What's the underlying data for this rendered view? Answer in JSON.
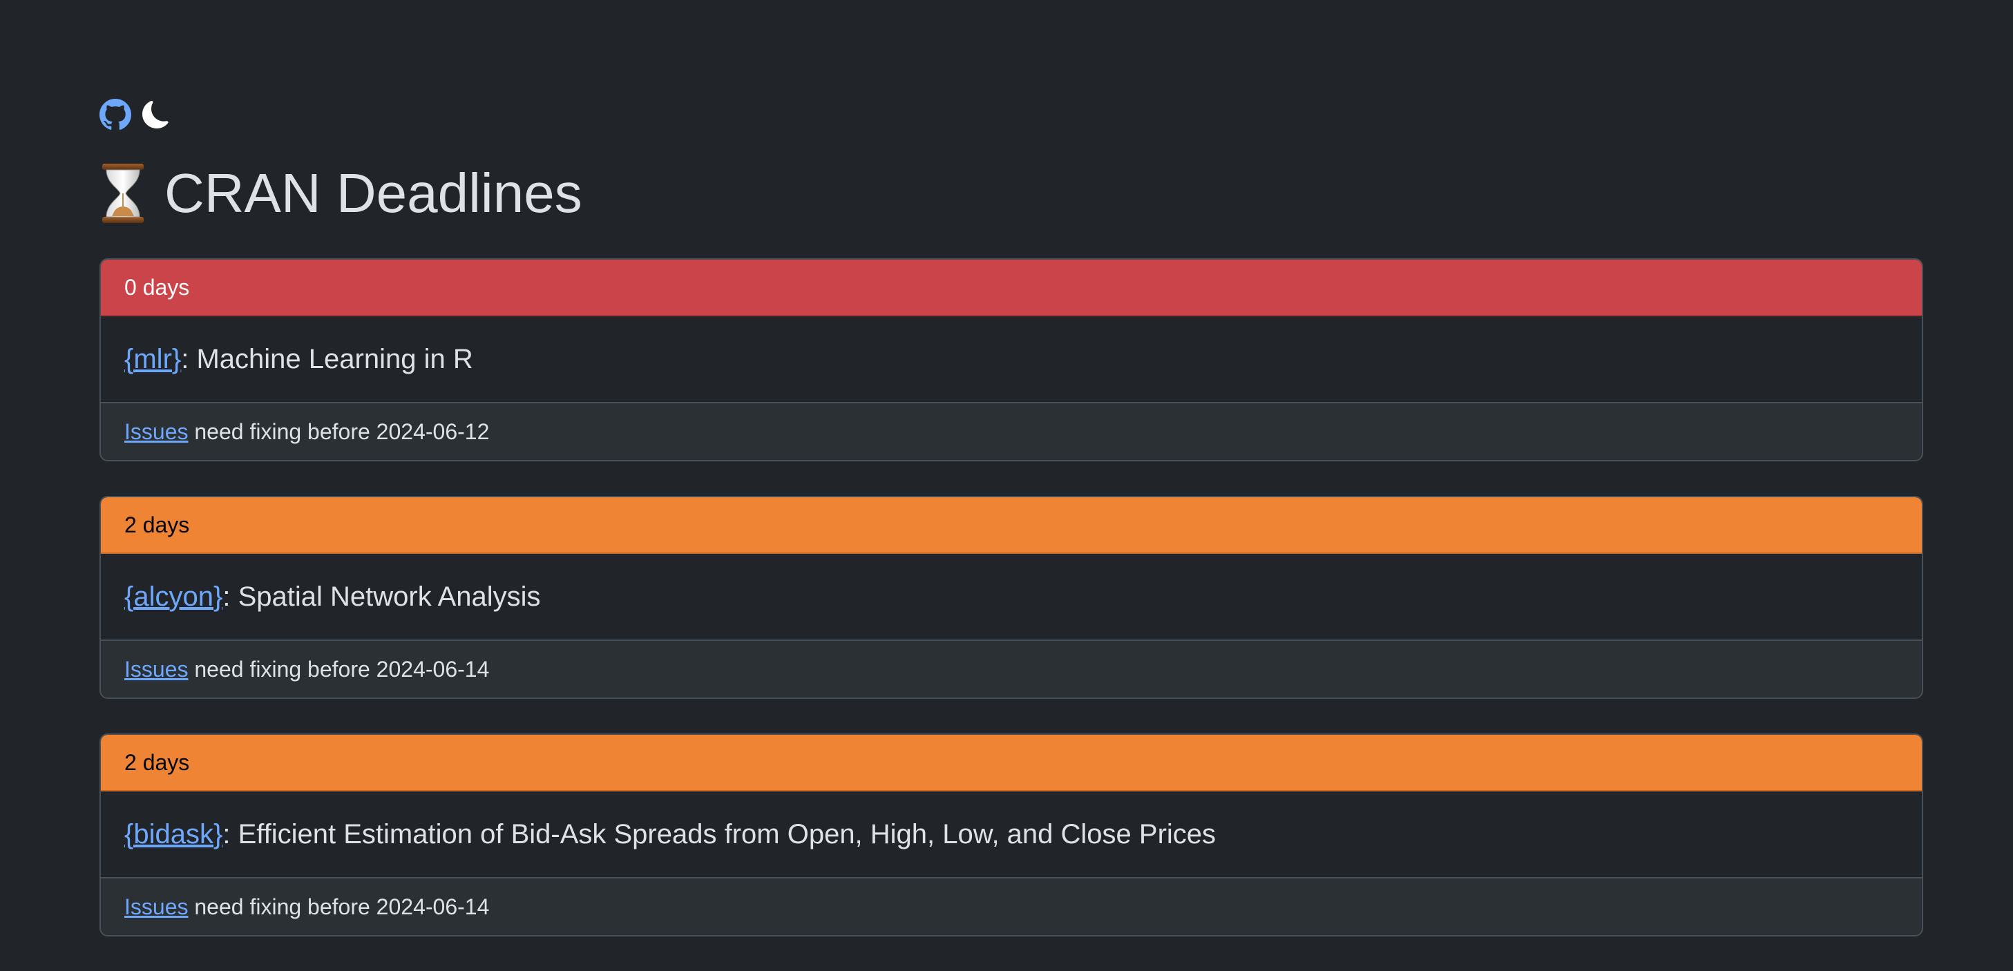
{
  "topbar": {
    "github_icon": "github-icon",
    "theme_icon": "moon-icon"
  },
  "page": {
    "title": "CRAN Deadlines",
    "title_icon": "hourglass-icon"
  },
  "colors": {
    "background": "#212529",
    "danger": "#cb444a",
    "warning": "#ee8434",
    "link": "#6ea8fe"
  },
  "cards": [
    {
      "days": "0 days",
      "status": "danger",
      "package": "{mlr}",
      "description": ": Machine Learning in R",
      "issues_link": "Issues",
      "footer_text": " need fixing before 2024-06-12"
    },
    {
      "days": "2 days",
      "status": "warning",
      "package": "{alcyon}",
      "description": ": Spatial Network Analysis",
      "issues_link": "Issues",
      "footer_text": " need fixing before 2024-06-14"
    },
    {
      "days": "2 days",
      "status": "warning",
      "package": "{bidask}",
      "description": ": Efficient Estimation of Bid-Ask Spreads from Open, High, Low, and Close Prices",
      "issues_link": "Issues",
      "footer_text": " need fixing before 2024-06-14"
    }
  ]
}
